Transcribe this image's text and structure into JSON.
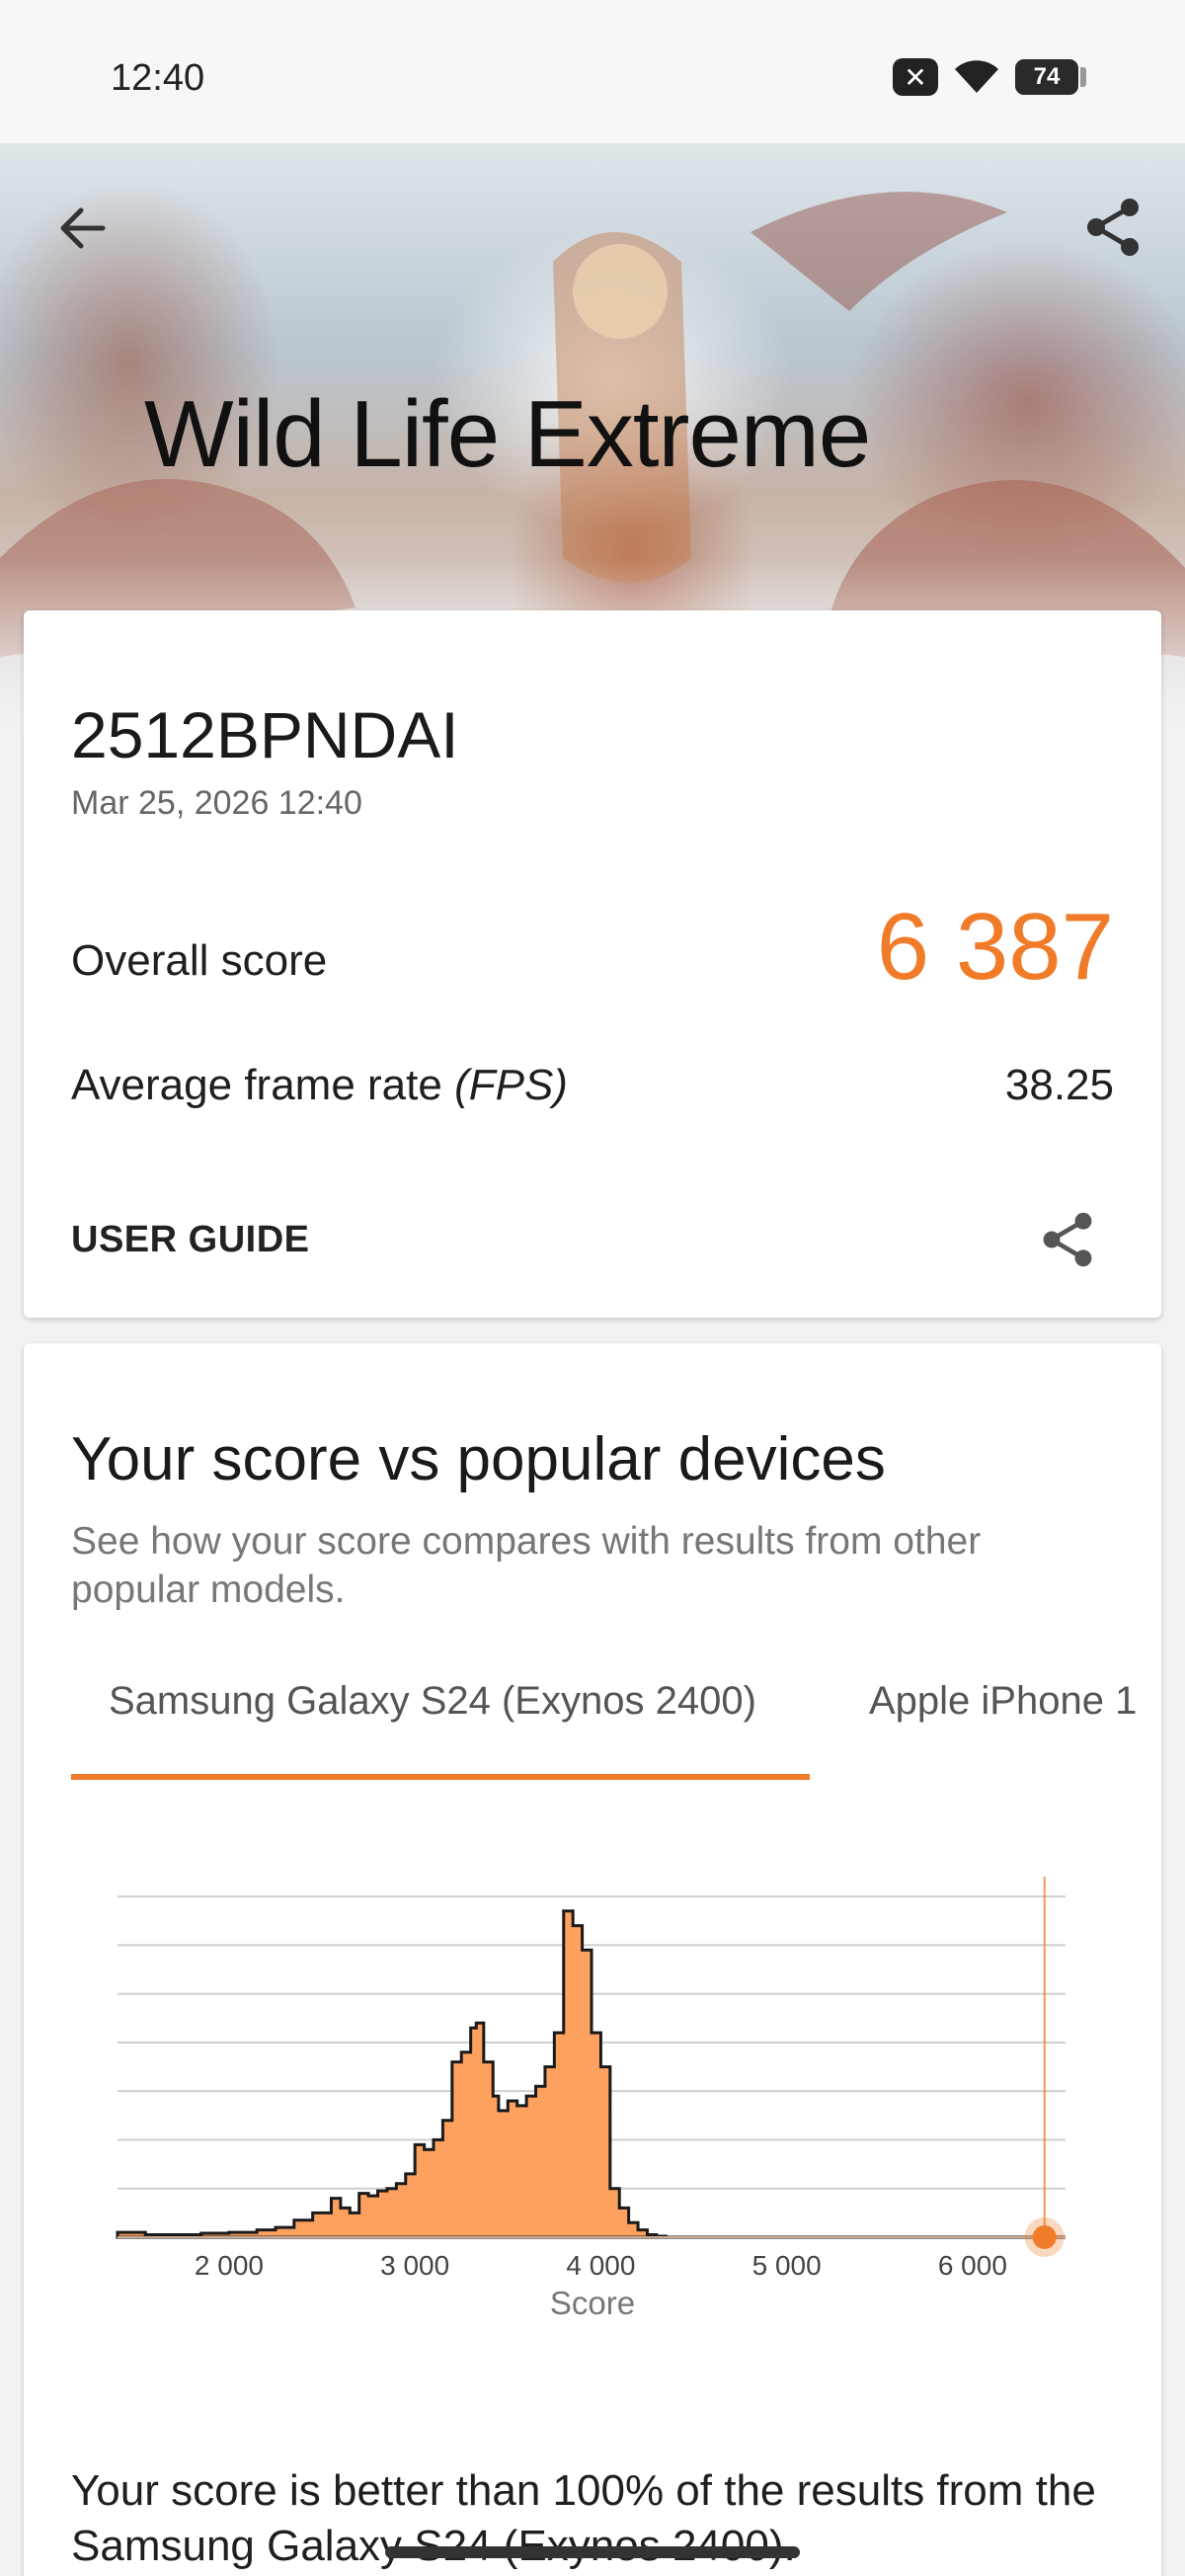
{
  "status_bar": {
    "time": "12:40",
    "battery_level": "74",
    "icons": [
      "notification-x-icon",
      "wifi-icon",
      "battery-icon"
    ]
  },
  "header": {
    "title": "Wild Life Extreme",
    "back_icon": "arrow-left-icon",
    "share_icon": "share-icon"
  },
  "result_card": {
    "device_name": "2512BPNDAI",
    "date": "Mar 25, 2026 12:40",
    "overall_label": "Overall score",
    "overall_value": "6 387",
    "fps_label": "Average frame rate ",
    "fps_unit": "(FPS)",
    "fps_value": "38.25",
    "user_guide_label": "USER GUIDE"
  },
  "comparison": {
    "title": "Your score vs popular devices",
    "subtitle": "See how your score compares with results from other popular models.",
    "tabs": [
      "Samsung Galaxy S24 (Exynos 2400)",
      "Apple iPhone 1"
    ],
    "active_tab": 0,
    "result_text": "Your score is better than 100% of the results from the Samsung Galaxy S24 (Exynos 2400)."
  },
  "colors": {
    "accent": "#f07c2a",
    "histogram_fill": "#ffa15e"
  },
  "chart_data": {
    "type": "area",
    "xlabel": "Score",
    "ylabel": "",
    "xlim": [
      1400,
      6500
    ],
    "ylim": [
      0,
      7
    ],
    "x_ticks": [
      2000,
      3000,
      4000,
      5000,
      6000
    ],
    "x_tick_labels": [
      "2 000",
      "3 000",
      "4 000",
      "5 000",
      "6 000"
    ],
    "grid": true,
    "your_score": 6387,
    "series": [
      {
        "x": [
          1400,
          1550,
          1700,
          1850,
          2000,
          2150,
          2250,
          2350,
          2450,
          2550,
          2600,
          2650,
          2700,
          2750,
          2800,
          2850,
          2900,
          2950,
          3000,
          3050,
          3100,
          3150,
          3200,
          3250,
          3300,
          3330,
          3370,
          3420,
          3450,
          3500,
          3550,
          3600,
          3650,
          3700,
          3750,
          3800,
          3850,
          3900,
          3950,
          4000,
          4050,
          4100,
          4150,
          4200,
          4250,
          4300,
          4350,
          4400,
          4450,
          4500,
          4550,
          4600,
          5000,
          6000,
          6500
        ],
        "y": [
          0.1,
          0.05,
          0.05,
          0.08,
          0.1,
          0.15,
          0.2,
          0.35,
          0.5,
          0.8,
          0.6,
          0.5,
          0.9,
          0.85,
          0.95,
          1.0,
          1.1,
          1.3,
          1.9,
          1.8,
          2.0,
          2.4,
          3.6,
          3.8,
          4.3,
          4.4,
          3.6,
          2.9,
          2.6,
          2.8,
          2.7,
          2.9,
          3.1,
          3.5,
          4.2,
          6.7,
          6.4,
          5.9,
          4.2,
          3.5,
          1.0,
          0.6,
          0.3,
          0.15,
          0.05,
          0.02,
          0,
          0,
          0,
          0,
          0,
          0,
          0,
          0,
          0
        ]
      }
    ]
  }
}
